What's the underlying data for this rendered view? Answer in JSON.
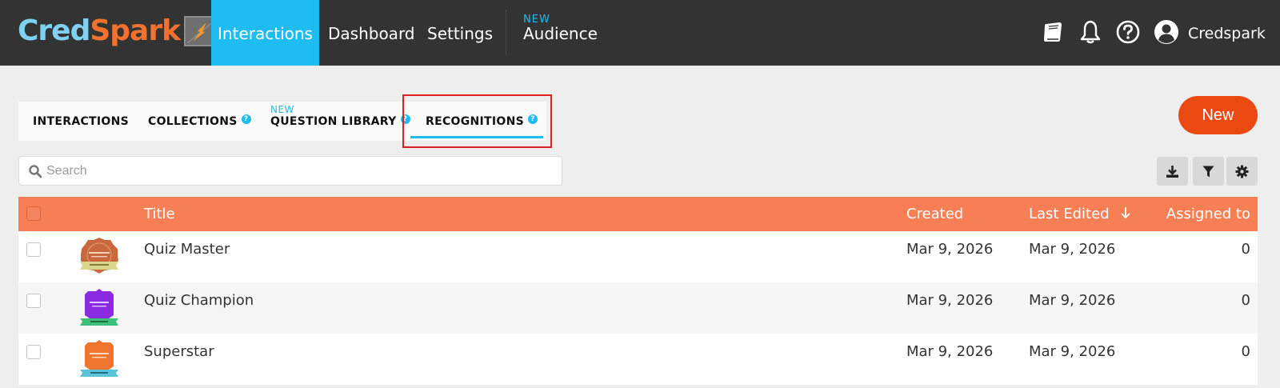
{
  "app": {
    "brand_part1": "Cred",
    "brand_part2": "Spark",
    "brand_colors": {
      "cred": "#7fd1f3",
      "spark": "#f3712f",
      "nav_bg": "#333333",
      "accent": "#1ebcf0",
      "table_header": "#f77f56",
      "new_button": "#ea4a12"
    }
  },
  "topnav": {
    "items": [
      {
        "label": "Interactions",
        "active": true
      },
      {
        "label": "Dashboard"
      },
      {
        "label": "Settings"
      },
      {
        "label": "Audience",
        "badge": "NEW"
      }
    ],
    "icons": [
      "book-icon",
      "bell-icon",
      "help-icon",
      "user-icon"
    ],
    "user_name": "Credspark"
  },
  "tabs": {
    "items": [
      {
        "label": "INTERACTIONS"
      },
      {
        "label": "COLLECTIONS",
        "help": "?"
      },
      {
        "label": "QUESTION LIBRARY",
        "help": "?",
        "badge": "NEW"
      },
      {
        "label": "RECOGNITIONS",
        "help": "?",
        "active": true
      }
    ]
  },
  "new_button_label": "New",
  "search": {
    "placeholder": "Search",
    "value": ""
  },
  "toolbar_icons": [
    "download-icon",
    "filter-icon",
    "gear-icon"
  ],
  "table": {
    "columns": [
      "Title",
      "Created",
      "Last Edited",
      "Assigned to"
    ],
    "sort_column": "Last Edited",
    "sort_direction": "descending",
    "rows": [
      {
        "title": "Quiz Master",
        "created": "Mar 9, 2026",
        "last_edited": "Mar 9, 2026",
        "assigned_to": "0",
        "badge_color": "#c9673d"
      },
      {
        "title": "Quiz Champion",
        "created": "Mar 9, 2026",
        "last_edited": "Mar 9, 2026",
        "assigned_to": "0",
        "badge_color": "#8a2be2"
      },
      {
        "title": "Superstar",
        "created": "Mar 9, 2026",
        "last_edited": "Mar 9, 2026",
        "assigned_to": "0",
        "badge_color": "#f0762f"
      }
    ]
  }
}
